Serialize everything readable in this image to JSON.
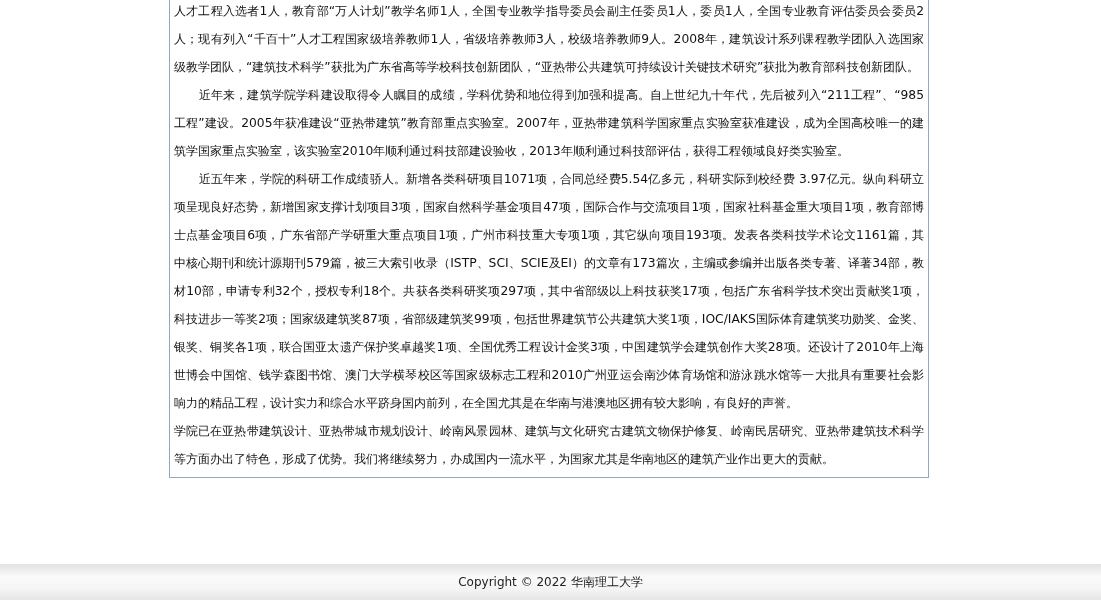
{
  "content": {
    "paragraphs": [
      {
        "indent": false,
        "text": "人才工程入选者1人，教育部“万人计划”教学名师1人，全国专业教学指导委员会副主任委员1人，委员1人，全国专业教育评估委员会委员2人；现有列入“千百十”人才工程国家级培养教师1人，省级培养教师3人，校级培养教师9人。2008年，建筑设计系列课程教学团队入选国家级教学团队，“建筑技术科学”获批为广东省高等学校科技创新团队，“亚热带公共建筑可持续设计关键技术研究”获批为教育部科技创新团队。"
      },
      {
        "indent": true,
        "text": "近年来，建筑学院学科建设取得令人瞩目的成绩，学科优势和地位得到加强和提高。自上世纪九十年代，先后被列入“211工程”、“985工程”建设。2005年获准建设“亚热带建筑”教育部重点实验室。2007年，亚热带建筑科学国家重点实验室获准建设，成为全国高校唯一的建筑学国家重点实验室，该实验室2010年顺利通过科技部建设验收，2013年顺利通过科技部评估，获得工程领域良好类实验室。"
      },
      {
        "indent": true,
        "text": "近五年来，学院的科研工作成绩骄人。新增各类科研项目1071项，合同总经费5.54亿多元，科研实际到校经费 3.97亿元。纵向科研立项呈现良好态势，新增国家支撑计划项目3项，国家自然科学基金项目47项，国际合作与交流项目1项，国家社科基金重大项目1项，教育部博士点基金项目6项，广东省部产学研重大重点项目1项，广州市科技重大专项1项，其它纵向项目193项。发表各类科技学术论文1161篇，其中核心期刊和统计源期刊579篇，被三大索引收录（ISTP、SCI、SCIE及EI）的文章有173篇次，主编或参编并出版各类专著、译著34部，教材10部，申请专利32个，授权专利18个。共获各类科研奖项297项，其中省部级以上科技获奖17项，包括广东省科学技术突出贡献奖1项，科技进步一等奖2项；国家级建筑奖87项，省部级建筑奖99项，包括世界建筑节公共建筑大奖1项，IOC/IAKS国际体育建筑奖功勋奖、金奖、银奖、铜奖各1项，联合国亚太遗产保护奖卓越奖1项、全国优秀工程设计金奖3项，中国建筑学会建筑创作大奖28项。还设计了2010年上海世博会中国馆、钱学森图书馆、澳门大学横琴校区等国家级标志工程和2010广州亚运会南沙体育场馆和游泳跳水馆等一大批具有重要社会影响力的精品工程，设计实力和综合水平跻身国内前列，在全国尤其是在华南与港澳地区拥有较大影响，有良好的声誉。"
      },
      {
        "indent": false,
        "text": "学院已在亚热带建筑设计、亚热带城市规划设计、岭南风景园林、建筑与文化研究古建筑文物保护修复、岭南民居研究、亚热带建筑技术科学等方面办出了特色，形成了优势。我们将继续努力，办成国内一流水平，为国家尤其是华南地区的建筑产业作出更大的贡献。"
      }
    ]
  },
  "footer": {
    "copyright": "Copyright © 2022 华南理工大学"
  }
}
